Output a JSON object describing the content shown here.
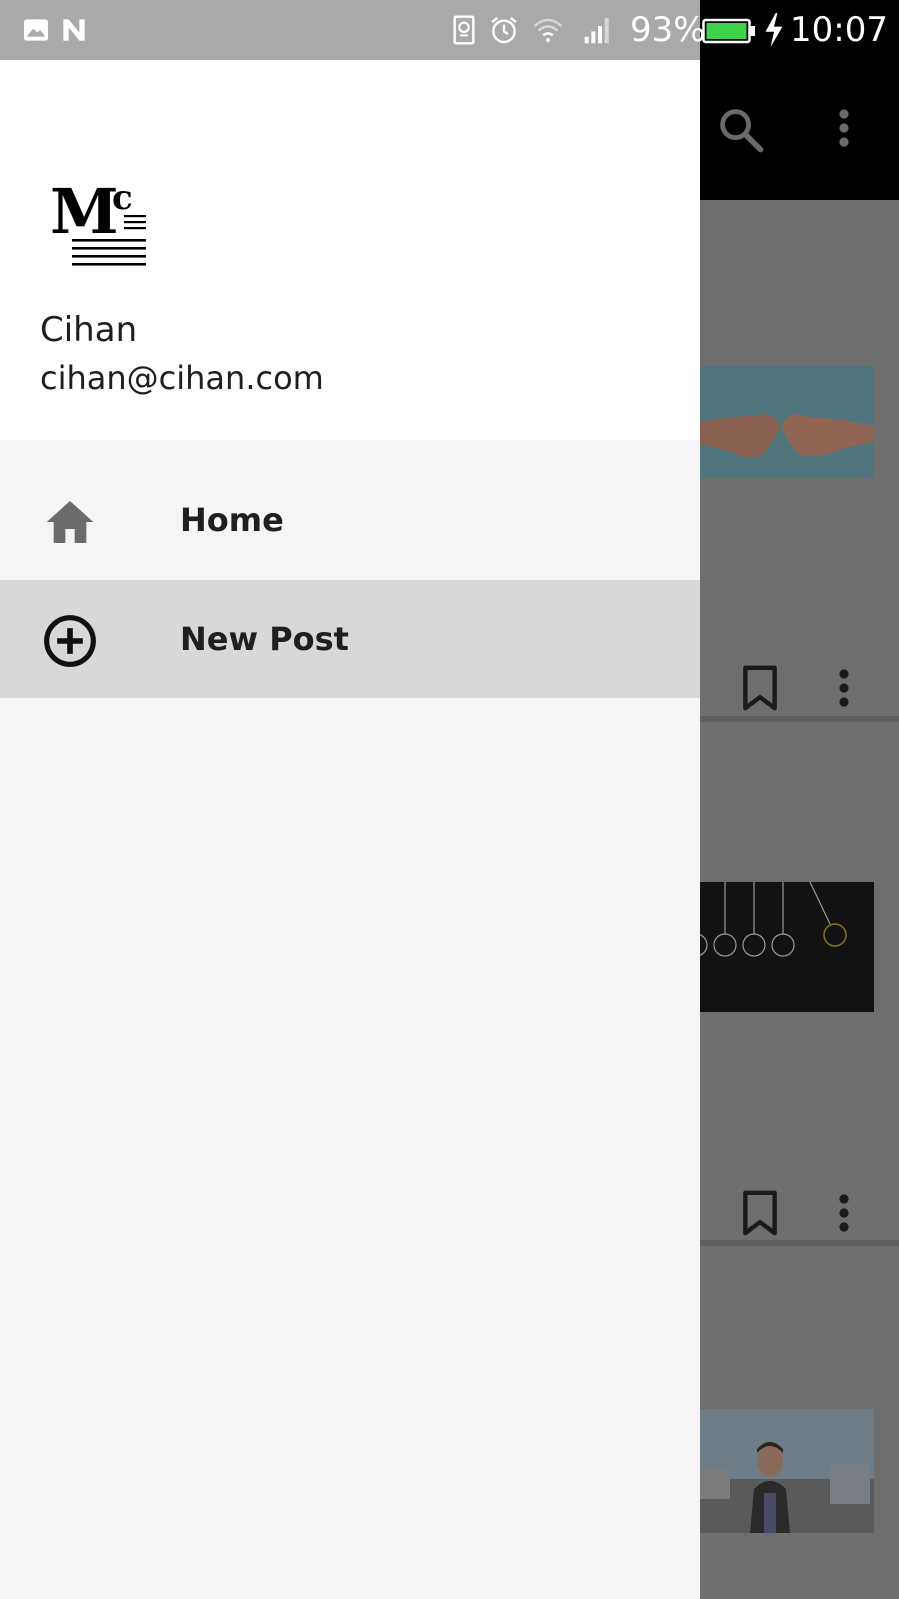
{
  "status_bar": {
    "battery_percent": "93%",
    "time": "10:07",
    "battery_color": "#3fd34a",
    "icons": [
      "image-icon",
      "n-icon",
      "sim-icon",
      "alarm-icon",
      "wifi-icon",
      "signal-icon",
      "battery-icon",
      "charging-icon"
    ]
  },
  "drawer": {
    "user": {
      "name": "Cihan",
      "email": "cihan@cihan.com"
    },
    "items": [
      {
        "label": "Home",
        "icon": "home-icon",
        "active": false
      },
      {
        "label": "New Post",
        "icon": "add-circle-icon",
        "active": true
      }
    ],
    "active_color": "#d9d7da",
    "background_color": "#f6f4f7"
  },
  "background_app": {
    "toolbar_icons": [
      "search-icon",
      "more-vert-icon"
    ],
    "card_action_icons": [
      "bookmark-icon",
      "more-vert-icon"
    ]
  }
}
